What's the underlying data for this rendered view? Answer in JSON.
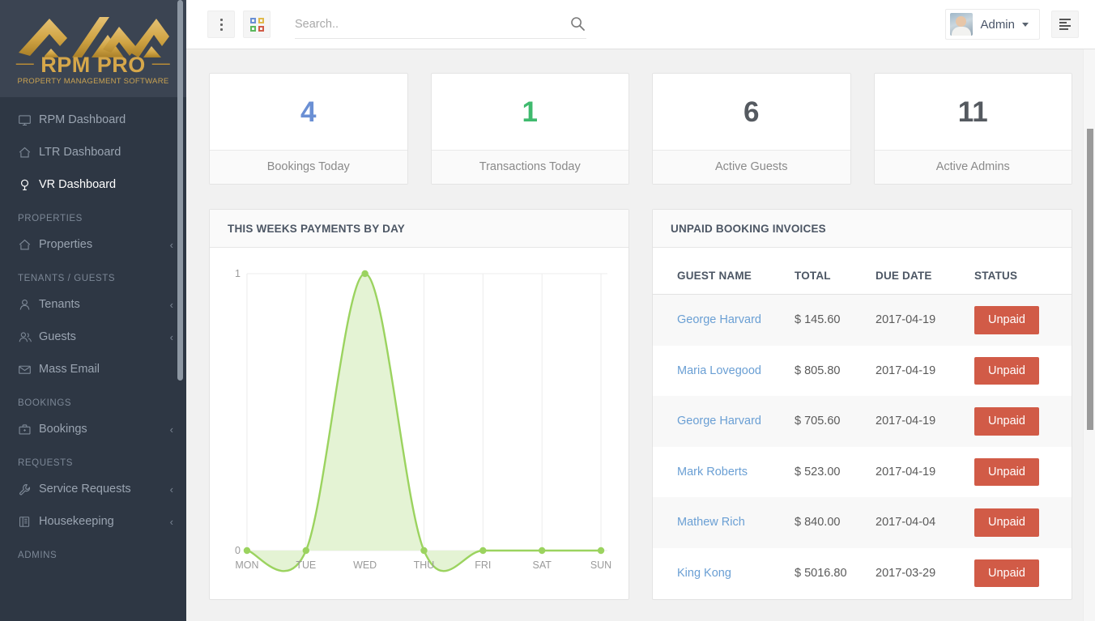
{
  "brand": {
    "name": "RPM PRO",
    "tagline": "PROPERTY MANAGEMENT SOFTWARE",
    "logo_color": "#d6a74a"
  },
  "sidebar": {
    "items": [
      {
        "type": "link",
        "label": "RPM Dashboard",
        "icon": "monitor-icon",
        "active": false,
        "caret": false
      },
      {
        "type": "link",
        "label": "LTR Dashboard",
        "icon": "home-icon",
        "active": false,
        "caret": false
      },
      {
        "type": "link",
        "label": "VR Dashboard",
        "icon": "umbrella-icon",
        "active": true,
        "caret": false
      },
      {
        "type": "section",
        "label": "PROPERTIES"
      },
      {
        "type": "link",
        "label": "Properties",
        "icon": "home-icon",
        "active": false,
        "caret": true
      },
      {
        "type": "section",
        "label": "TENANTS / GUESTS"
      },
      {
        "type": "link",
        "label": "Tenants",
        "icon": "user-icon",
        "active": false,
        "caret": true
      },
      {
        "type": "link",
        "label": "Guests",
        "icon": "users-icon",
        "active": false,
        "caret": true
      },
      {
        "type": "link",
        "label": "Mass Email",
        "icon": "envelope-icon",
        "active": false,
        "caret": false
      },
      {
        "type": "section",
        "label": "BOOKINGS"
      },
      {
        "type": "link",
        "label": "Bookings",
        "icon": "briefcase-icon",
        "active": false,
        "caret": true
      },
      {
        "type": "section",
        "label": "REQUESTS"
      },
      {
        "type": "link",
        "label": "Service Requests",
        "icon": "wrench-icon",
        "active": false,
        "caret": true
      },
      {
        "type": "link",
        "label": "Housekeeping",
        "icon": "book-icon",
        "active": false,
        "caret": true
      },
      {
        "type": "section",
        "label": "ADMINS"
      }
    ]
  },
  "topbar": {
    "menu_icon": "kebab-menu-icon",
    "apps_icon": "grid-apps-icon",
    "search": {
      "value": "",
      "placeholder": "Search.."
    },
    "search_icon": "search-icon",
    "user": {
      "name": "Admin",
      "avatar": "user-avatar"
    },
    "toggle_icon": "list-toggle-icon"
  },
  "stats": [
    {
      "value": "4",
      "label": "Bookings Today",
      "color": "#6a8fd4"
    },
    {
      "value": "1",
      "label": "Transactions Today",
      "color": "#3fba6e"
    },
    {
      "value": "6",
      "label": "Active Guests",
      "color": "#555a60"
    },
    {
      "value": "11",
      "label": "Active Admins",
      "color": "#555a60"
    }
  ],
  "chart_panel": {
    "title": "THIS WEEKS PAYMENTS BY DAY"
  },
  "chart_data": {
    "type": "area",
    "title": "THIS WEEKS PAYMENTS BY DAY",
    "categories": [
      "MON",
      "TUE",
      "WED",
      "THU",
      "FRI",
      "SAT",
      "SUN"
    ],
    "values": [
      0,
      0,
      1,
      0,
      0,
      0,
      0
    ],
    "series": [
      {
        "name": "Payments",
        "values": [
          0,
          0,
          1,
          0,
          0,
          0,
          0
        ]
      }
    ],
    "xlabel": "",
    "ylabel": "",
    "ylim": [
      0,
      1
    ],
    "ytick_labels": [
      "0",
      "1"
    ],
    "grid": true,
    "legend": "none",
    "line_color": "#9bd35f",
    "fill_color": "#e4f3d4",
    "marker_color": "#9bd35f",
    "smooth": true
  },
  "invoices_panel": {
    "title": "UNPAID BOOKING INVOICES",
    "columns": [
      "GUEST NAME",
      "TOTAL",
      "DUE DATE",
      "STATUS"
    ],
    "rows": [
      {
        "guest": "George Harvard",
        "total": "$ 145.60",
        "due": "2017-04-19",
        "status": "Unpaid"
      },
      {
        "guest": "Maria Lovegood",
        "total": "$ 805.80",
        "due": "2017-04-19",
        "status": "Unpaid"
      },
      {
        "guest": "George Harvard",
        "total": "$ 705.60",
        "due": "2017-04-19",
        "status": "Unpaid"
      },
      {
        "guest": "Mark Roberts",
        "total": "$ 523.00",
        "due": "2017-04-19",
        "status": "Unpaid"
      },
      {
        "guest": "Mathew Rich",
        "total": "$ 840.00",
        "due": "2017-04-04",
        "status": "Unpaid"
      },
      {
        "guest": "King Kong",
        "total": "$ 5016.80",
        "due": "2017-03-29",
        "status": "Unpaid"
      }
    ],
    "status_color": "#d15b47",
    "link_color": "#6a9fd4"
  }
}
